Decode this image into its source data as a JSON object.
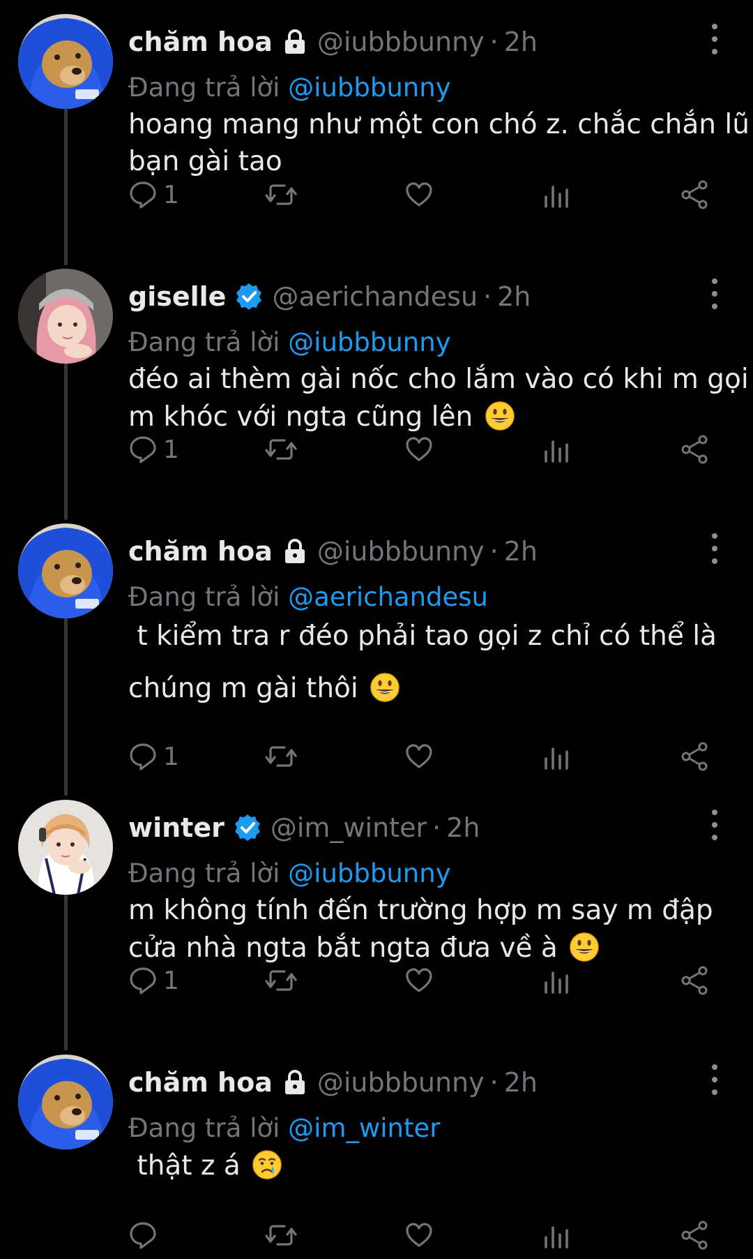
{
  "colors": {
    "background": "#000000",
    "text": "#e7e9ea",
    "secondary": "#71767b",
    "link": "#1d9bf0",
    "verified": "#1d9bf0",
    "thread_line": "#333639"
  },
  "tweets": [
    {
      "display_name": "chăm hoa",
      "badge": "lock-icon",
      "handle": "@iubbbunny",
      "separator": "·",
      "time": "2h",
      "reply_prefix": "Đang trả lời",
      "reply_to": "@iubbbunny",
      "lines": [
        "hoang mang như một con chó z. chắc chắn lũ",
        "bạn gài tao"
      ],
      "emoji": "",
      "reply_count": "1"
    },
    {
      "display_name": "giselle",
      "badge": "verified-icon",
      "handle": "@aerichandesu",
      "separator": "·",
      "time": "2h",
      "reply_prefix": "Đang trả lời",
      "reply_to": "@iubbbunny",
      "lines": [
        "đéo ai thèm gài nốc cho lắm vào có khi m gọi",
        "m khóc với ngta cũng lên"
      ],
      "emoji": "grinning-face-emoji",
      "reply_count": "1"
    },
    {
      "display_name": "chăm hoa",
      "badge": "lock-icon",
      "handle": "@iubbbunny",
      "separator": "·",
      "time": "2h",
      "reply_prefix": "Đang trả lời",
      "reply_to": "@aerichandesu",
      "lines": [
        " t kiểm tra r đéo phải tao gọi z chỉ có thể là",
        "chúng m gài thôi"
      ],
      "emoji": "grinning-face-emoji",
      "reply_count": "1"
    },
    {
      "display_name": "winter",
      "badge": "verified-icon",
      "handle": "@im_winter",
      "separator": "·",
      "time": "2h",
      "reply_prefix": "Đang trả lời",
      "reply_to": "@iubbbunny",
      "lines": [
        "m không tính đến trường hợp m say m đập",
        "cửa nhà ngta bắt ngta đưa về à"
      ],
      "emoji": "grinning-face-emoji",
      "reply_count": "1"
    },
    {
      "display_name": "chăm hoa",
      "badge": "lock-icon",
      "handle": "@iubbbunny",
      "separator": "·",
      "time": "2h",
      "reply_prefix": "Đang trả lời",
      "reply_to": "@im_winter",
      "lines": [
        " thật z á"
      ],
      "emoji": "crying-face-emoji",
      "reply_count": ""
    }
  ]
}
